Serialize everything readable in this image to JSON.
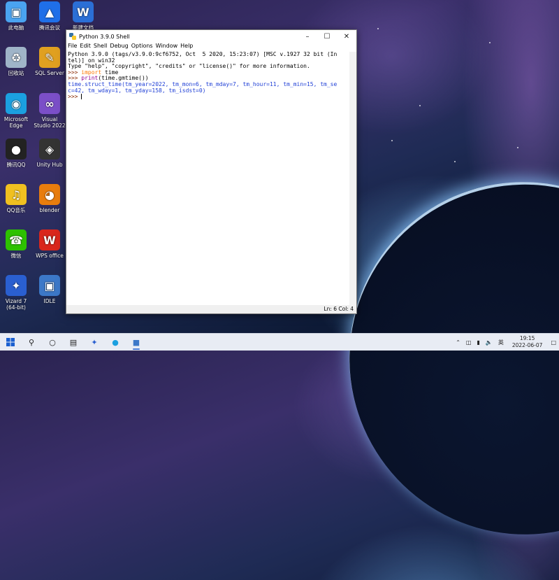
{
  "desktop": {
    "icons": [
      {
        "label": "此电脑",
        "icon": "computer-icon",
        "color": "#4aa3f0"
      },
      {
        "label": "腾讯会议",
        "icon": "meeting-icon",
        "color": "#1f6fe8"
      },
      {
        "label": "新建文档",
        "icon": "word-doc-icon",
        "color": "#2b6fd6"
      },
      {
        "label": "回收站",
        "icon": "recycle-bin-icon",
        "color": "#9fb4c8"
      },
      {
        "label": "SQL Server",
        "icon": "sql-server-icon",
        "color": "#e0a020"
      },
      {
        "label": "Microsoft Edge",
        "icon": "edge-icon",
        "color": "#1ba0e0"
      },
      {
        "label": "Visual Studio 2022",
        "icon": "visual-studio-icon",
        "color": "#7b4fc8"
      },
      {
        "label": "腾讯QQ",
        "icon": "qq-icon",
        "color": "#222222"
      },
      {
        "label": "Unity Hub",
        "icon": "unity-icon",
        "color": "#333333"
      },
      {
        "label": "QQ音乐",
        "icon": "qq-music-icon",
        "color": "#f0c020"
      },
      {
        "label": "blender",
        "icon": "blender-icon",
        "color": "#e87d0d"
      },
      {
        "label": "微信",
        "icon": "wechat-icon",
        "color": "#2dc100"
      },
      {
        "label": "WPS office",
        "icon": "wps-icon",
        "color": "#d9261c"
      },
      {
        "label": "Vizard 7 (64-bit)",
        "icon": "vizard-icon",
        "color": "#2a5fd0"
      },
      {
        "label": "IDLE",
        "icon": "idle-icon",
        "color": "#3c78c8"
      }
    ]
  },
  "window": {
    "title": "Python 3.9.0 Shell",
    "menu": [
      "File",
      "Edit",
      "Shell",
      "Debug",
      "Options",
      "Window",
      "Help"
    ],
    "lines": {
      "l1": "Python 3.9.0 (tags/v3.9.0:9cf6752, Oct  5 2020, 15:23:07) [MSC v.1927 32 bit (In",
      "l2": "tel)] on win32",
      "l3": "Type \"help\", \"copyright\", \"credits\" or \"license()\" for more information.",
      "p": ">>> ",
      "kw_import": "import",
      "import_rest": " time",
      "print_kw": "print",
      "print_rest": "(time.gmtime())",
      "out1": "time.struct_time(tm_year=2022, tm_mon=6, tm_mday=7, tm_hour=11, tm_min=15, tm_se",
      "out2": "c=42, tm_wday=1, tm_yday=158, tm_isdst=0)",
      "last_prompt": ">>> "
    },
    "status": "Ln: 6  Col: 4"
  },
  "taskbar": {
    "lang": "英",
    "time": "19:15",
    "date": "2022-06-07"
  }
}
